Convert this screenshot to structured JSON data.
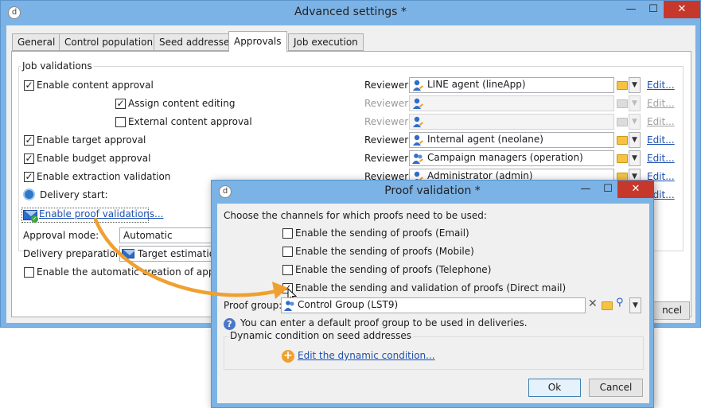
{
  "main_window": {
    "title": "Advanced settings *",
    "app_icon": "d",
    "minimize": "—",
    "maximize": "☐",
    "close": "✕"
  },
  "tabs": [
    "General",
    "Control population",
    "Seed addresses",
    "Approvals",
    "Job execution"
  ],
  "active_tab": "Approvals",
  "job_validations": {
    "group_label": "Job validations",
    "enable_content_approval": {
      "label": "Enable content approval",
      "checked": true
    },
    "assign_content_editing": {
      "label": "Assign content editing",
      "checked": true
    },
    "external_content_approval": {
      "label": "External content approval",
      "checked": false
    },
    "enable_target_approval": {
      "label": "Enable target approval",
      "checked": true
    },
    "enable_budget_approval": {
      "label": "Enable budget approval",
      "checked": true
    },
    "enable_extraction_validation": {
      "label": "Enable extraction validation",
      "checked": true
    },
    "delivery_start": "Delivery start:",
    "enable_proof_validations": "Enable proof validations...",
    "reviewer_label": "Reviewer:",
    "edit_link": "Edit...",
    "reviewers": [
      {
        "value": "LINE agent (lineApp)",
        "enabled": true
      },
      {
        "value": "",
        "enabled": false
      },
      {
        "value": "",
        "enabled": false
      },
      {
        "value": "Internal agent (neolane)",
        "enabled": true
      },
      {
        "value": "Campaign managers (operation)",
        "enabled": true
      },
      {
        "value": "Administrator (admin)",
        "enabled": true
      },
      {
        "value": "",
        "enabled": true
      }
    ]
  },
  "approval_mode": {
    "label": "Approval mode:",
    "value": "Automatic"
  },
  "delivery_preparation": {
    "label": "Delivery preparation:",
    "value": "Target estimation"
  },
  "auto_creation": {
    "label": "Enable the automatic creation of approval",
    "checked": false
  },
  "main_cancel_fragment": "ncel",
  "proof_dialog": {
    "title": "Proof validation *",
    "app_icon": "d",
    "minimize": "—",
    "maximize": "☐",
    "close": "✕",
    "instruction": "Choose the channels for which proofs need to be used:",
    "channels": [
      {
        "label": "Enable the sending of proofs (Email)",
        "checked": false
      },
      {
        "label": "Enable the sending of proofs (Mobile)",
        "checked": false
      },
      {
        "label": "Enable the sending of proofs (Telephone)",
        "checked": false
      },
      {
        "label": "Enable the sending and validation of proofs (Direct mail)",
        "checked": true
      }
    ],
    "proof_group_label": "Proof group:",
    "proof_group_value": "Control Group (LST9)",
    "info_text": "You can enter a default proof group to be used in deliveries.",
    "dynamic_group_label": "Dynamic condition on seed addresses",
    "edit_dynamic": "Edit the dynamic condition...",
    "ok": "Ok",
    "cancel": "Cancel"
  },
  "colors": {
    "titlebar": "#7cb3e6",
    "close_button": "#c7382c",
    "link": "#1d50b0",
    "arrow": "#f0a030"
  }
}
